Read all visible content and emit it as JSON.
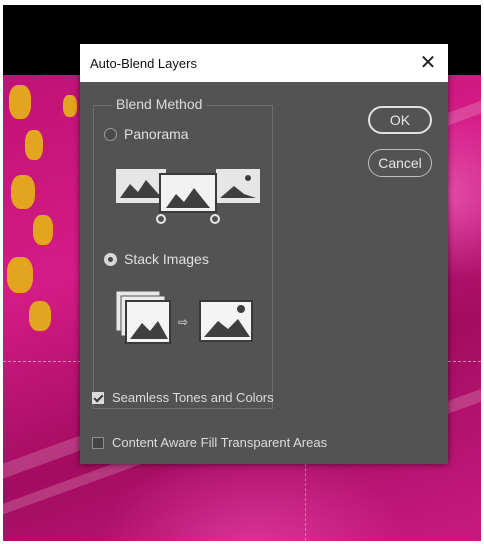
{
  "dialog": {
    "title": "Auto-Blend Layers",
    "close_icon": "close-icon"
  },
  "blend_method": {
    "legend": "Blend Method",
    "options": [
      {
        "label": "Panorama",
        "selected": false,
        "icon": "panorama-illustration"
      },
      {
        "label": "Stack Images",
        "selected": true,
        "icon": "stack-images-illustration"
      }
    ]
  },
  "buttons": {
    "ok": "OK",
    "cancel": "Cancel"
  },
  "checkboxes": [
    {
      "label": "Seamless Tones and Colors",
      "checked": true
    },
    {
      "label": "Content Aware Fill Transparent Areas",
      "checked": false
    }
  ],
  "colors": {
    "dialog_bg": "#535353",
    "photo_magenta": "#c01274",
    "flower_yellow": "#e3a51f"
  }
}
